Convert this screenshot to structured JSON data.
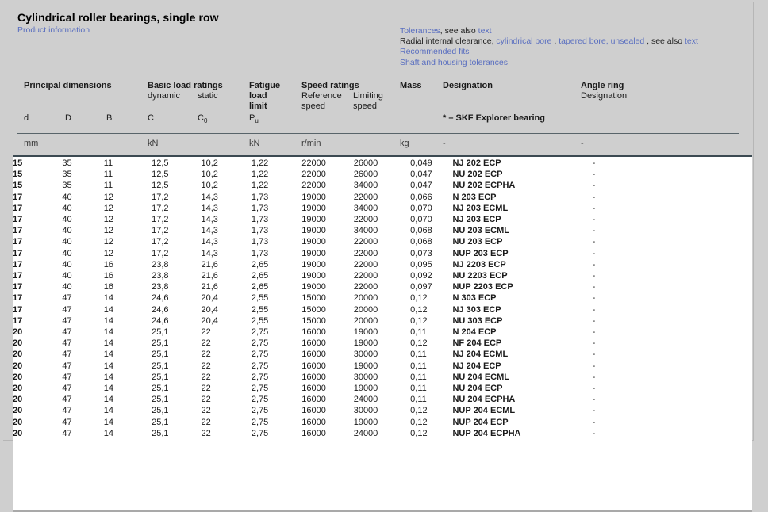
{
  "header": {
    "title": "Cylindrical roller bearings, single row",
    "product_info_link": "Product information",
    "links": {
      "line1": {
        "tolerances": "Tolerances",
        "sep": ", see also ",
        "text": "text"
      },
      "line2": {
        "prefix": "Radial internal clearance,",
        "cylindrical_bore": "cylindrical bore",
        "comma1": " , ",
        "tapered_bore_unsealed": "tapered bore, unsealed",
        "mid": " , see also ",
        "text": "text"
      },
      "line3": "Recommended fits",
      "line4": "Shaft and housing tolerances"
    }
  },
  "table": {
    "groups": {
      "principal_dimensions": "Principal dimensions",
      "basic_load_ratings": "Basic load ratings",
      "dynamic": "dynamic",
      "static": "static",
      "fatigue_load_limit_l1": "Fatigue",
      "fatigue_load_limit_l2": "load",
      "fatigue_load_limit_l3": "limit",
      "speed_ratings": "Speed ratings",
      "reference": "Reference",
      "reference2": "speed",
      "limiting": "Limiting",
      "limiting2": "speed",
      "mass": "Mass",
      "designation": "Designation",
      "angle_ring": "Angle ring",
      "angle_ring_designation": "Designation",
      "explorer_note": "* – SKF Explorer bearing"
    },
    "symbols": {
      "d": "d",
      "D": "D",
      "B": "B",
      "C": "C",
      "C0": "C",
      "C0_sub": "0",
      "Pu": "P",
      "Pu_sub": "u"
    },
    "units": {
      "mm": "mm",
      "kN_load": "kN",
      "kN_fatigue": "kN",
      "rmin": "r/min",
      "kg": "kg",
      "designation_dash": "-",
      "angle_dash": "-"
    },
    "rows": [
      {
        "d": "15",
        "D": "35",
        "B": "11",
        "C": "12,5",
        "C0": "10,2",
        "Pu": "1,22",
        "ref": "22000",
        "lim": "26000",
        "mass": "0,049",
        "designation": "NJ 202 ECP",
        "angle": "-"
      },
      {
        "d": "15",
        "D": "35",
        "B": "11",
        "C": "12,5",
        "C0": "10,2",
        "Pu": "1,22",
        "ref": "22000",
        "lim": "26000",
        "mass": "0,047",
        "designation": "NU 202 ECP",
        "angle": "-"
      },
      {
        "d": "15",
        "D": "35",
        "B": "11",
        "C": "12,5",
        "C0": "10,2",
        "Pu": "1,22",
        "ref": "22000",
        "lim": "34000",
        "mass": "0,047",
        "designation": "NU 202 ECPHA",
        "angle": "-"
      },
      {
        "d": "17",
        "D": "40",
        "B": "12",
        "C": "17,2",
        "C0": "14,3",
        "Pu": "1,73",
        "ref": "19000",
        "lim": "22000",
        "mass": "0,066",
        "designation": "N 203 ECP",
        "angle": "-"
      },
      {
        "d": "17",
        "D": "40",
        "B": "12",
        "C": "17,2",
        "C0": "14,3",
        "Pu": "1,73",
        "ref": "19000",
        "lim": "34000",
        "mass": "0,070",
        "designation": "NJ 203 ECML",
        "angle": "-"
      },
      {
        "d": "17",
        "D": "40",
        "B": "12",
        "C": "17,2",
        "C0": "14,3",
        "Pu": "1,73",
        "ref": "19000",
        "lim": "22000",
        "mass": "0,070",
        "designation": "NJ 203 ECP",
        "angle": "-"
      },
      {
        "d": "17",
        "D": "40",
        "B": "12",
        "C": "17,2",
        "C0": "14,3",
        "Pu": "1,73",
        "ref": "19000",
        "lim": "34000",
        "mass": "0,068",
        "designation": "NU 203 ECML",
        "angle": "-"
      },
      {
        "d": "17",
        "D": "40",
        "B": "12",
        "C": "17,2",
        "C0": "14,3",
        "Pu": "1,73",
        "ref": "19000",
        "lim": "22000",
        "mass": "0,068",
        "designation": "NU 203 ECP",
        "angle": "-"
      },
      {
        "d": "17",
        "D": "40",
        "B": "12",
        "C": "17,2",
        "C0": "14,3",
        "Pu": "1,73",
        "ref": "19000",
        "lim": "22000",
        "mass": "0,073",
        "designation": "NUP 203 ECP",
        "angle": "-"
      },
      {
        "d": "17",
        "D": "40",
        "B": "16",
        "C": "23,8",
        "C0": "21,6",
        "Pu": "2,65",
        "ref": "19000",
        "lim": "22000",
        "mass": "0,095",
        "designation": "NJ 2203 ECP",
        "angle": "-"
      },
      {
        "d": "17",
        "D": "40",
        "B": "16",
        "C": "23,8",
        "C0": "21,6",
        "Pu": "2,65",
        "ref": "19000",
        "lim": "22000",
        "mass": "0,092",
        "designation": "NU 2203 ECP",
        "angle": "-"
      },
      {
        "d": "17",
        "D": "40",
        "B": "16",
        "C": "23,8",
        "C0": "21,6",
        "Pu": "2,65",
        "ref": "19000",
        "lim": "22000",
        "mass": "0,097",
        "designation": "NUP 2203 ECP",
        "angle": "-"
      },
      {
        "d": "17",
        "D": "47",
        "B": "14",
        "C": "24,6",
        "C0": "20,4",
        "Pu": "2,55",
        "ref": "15000",
        "lim": "20000",
        "mass": "0,12",
        "designation": "N 303 ECP",
        "angle": "-"
      },
      {
        "d": "17",
        "D": "47",
        "B": "14",
        "C": "24,6",
        "C0": "20,4",
        "Pu": "2,55",
        "ref": "15000",
        "lim": "20000",
        "mass": "0,12",
        "designation": "NJ 303 ECP",
        "angle": "-"
      },
      {
        "d": "17",
        "D": "47",
        "B": "14",
        "C": "24,6",
        "C0": "20,4",
        "Pu": "2,55",
        "ref": "15000",
        "lim": "20000",
        "mass": "0,12",
        "designation": "NU 303 ECP",
        "angle": "-"
      },
      {
        "d": "20",
        "D": "47",
        "B": "14",
        "C": "25,1",
        "C0": "22",
        "Pu": "2,75",
        "ref": "16000",
        "lim": "19000",
        "mass": "0,11",
        "designation": "N 204 ECP",
        "angle": "-"
      },
      {
        "d": "20",
        "D": "47",
        "B": "14",
        "C": "25,1",
        "C0": "22",
        "Pu": "2,75",
        "ref": "16000",
        "lim": "19000",
        "mass": "0,12",
        "designation": "NF 204 ECP",
        "angle": "-"
      },
      {
        "d": "20",
        "D": "47",
        "B": "14",
        "C": "25,1",
        "C0": "22",
        "Pu": "2,75",
        "ref": "16000",
        "lim": "30000",
        "mass": "0,11",
        "designation": "NJ 204 ECML",
        "angle": "-"
      },
      {
        "d": "20",
        "D": "47",
        "B": "14",
        "C": "25,1",
        "C0": "22",
        "Pu": "2,75",
        "ref": "16000",
        "lim": "19000",
        "mass": "0,11",
        "designation": "NJ 204 ECP",
        "angle": "-"
      },
      {
        "d": "20",
        "D": "47",
        "B": "14",
        "C": "25,1",
        "C0": "22",
        "Pu": "2,75",
        "ref": "16000",
        "lim": "30000",
        "mass": "0,11",
        "designation": "NU 204 ECML",
        "angle": "-"
      },
      {
        "d": "20",
        "D": "47",
        "B": "14",
        "C": "25,1",
        "C0": "22",
        "Pu": "2,75",
        "ref": "16000",
        "lim": "19000",
        "mass": "0,11",
        "designation": "NU 204 ECP",
        "angle": "-"
      },
      {
        "d": "20",
        "D": "47",
        "B": "14",
        "C": "25,1",
        "C0": "22",
        "Pu": "2,75",
        "ref": "16000",
        "lim": "24000",
        "mass": "0,11",
        "designation": "NU 204 ECPHA",
        "angle": "-"
      },
      {
        "d": "20",
        "D": "47",
        "B": "14",
        "C": "25,1",
        "C0": "22",
        "Pu": "2,75",
        "ref": "16000",
        "lim": "30000",
        "mass": "0,12",
        "designation": "NUP 204 ECML",
        "angle": "-"
      },
      {
        "d": "20",
        "D": "47",
        "B": "14",
        "C": "25,1",
        "C0": "22",
        "Pu": "2,75",
        "ref": "16000",
        "lim": "19000",
        "mass": "0,12",
        "designation": "NUP 204 ECP",
        "angle": "-"
      },
      {
        "d": "20",
        "D": "47",
        "B": "14",
        "C": "25,1",
        "C0": "22",
        "Pu": "2,75",
        "ref": "16000",
        "lim": "24000",
        "mass": "0,12",
        "designation": "NUP 204 ECPHA",
        "angle": "-"
      }
    ]
  },
  "colors": {
    "page_background": "#cfcfcf",
    "link": "#5a6fc0",
    "rule": "#58646a",
    "rule_heavy": "#3c4a52",
    "body_background": "#ffffff",
    "text": "#1a1a1a"
  }
}
